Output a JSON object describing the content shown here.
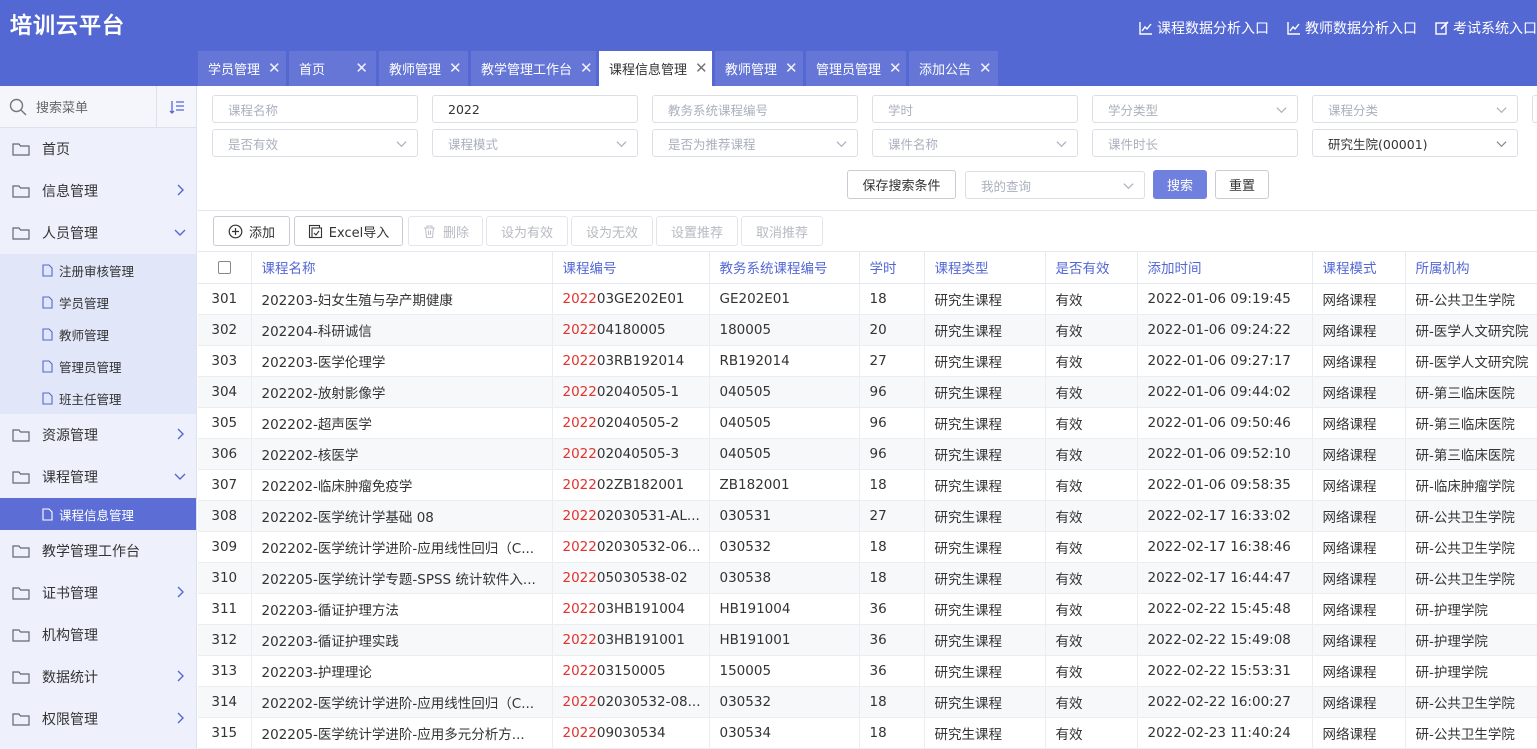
{
  "app": {
    "title": "培训云平台"
  },
  "header_links": [
    {
      "label": "课程数据分析入口",
      "icon": "chart-icon"
    },
    {
      "label": "教师数据分析入口",
      "icon": "chart-icon"
    },
    {
      "label": "考试系统入口",
      "icon": "edit-icon"
    }
  ],
  "tabs": [
    {
      "label": "学员管理",
      "active": false
    },
    {
      "label": "首页",
      "active": false
    },
    {
      "label": "教师管理",
      "active": false
    },
    {
      "label": "教学管理工作台",
      "active": false
    },
    {
      "label": "课程信息管理",
      "active": true
    },
    {
      "label": "教师管理",
      "active": false
    },
    {
      "label": "管理员管理",
      "active": false
    },
    {
      "label": "添加公告",
      "active": false
    }
  ],
  "sidebar": {
    "search_placeholder": "搜索菜单",
    "items": [
      {
        "label": "首页"
      },
      {
        "label": "信息管理"
      },
      {
        "label": "人员管理"
      },
      {
        "label": "资源管理"
      },
      {
        "label": "课程管理"
      },
      {
        "label": "教学管理工作台"
      },
      {
        "label": "证书管理"
      },
      {
        "label": "机构管理"
      },
      {
        "label": "数据统计"
      },
      {
        "label": "权限管理"
      }
    ],
    "personnel_sub": [
      "注册审核管理",
      "学员管理",
      "教师管理",
      "管理员管理",
      "班主任管理"
    ],
    "course_sub": [
      "课程信息管理"
    ]
  },
  "filters": {
    "course_name": "课程名称",
    "year": "2022",
    "edu_code": "教务系统课程编号",
    "hours": "学时",
    "credit_type": "学分类型",
    "course_category": "课程分类",
    "is_valid": "是否有效",
    "course_mode": "课程模式",
    "is_recommended": "是否为推荐课程",
    "courseware_name": "课件名称",
    "courseware_duration": "课件时长",
    "org": "研究生院(00001)",
    "my_query": "我的查询",
    "save_label": "保存搜索条件",
    "search_label": "搜索",
    "reset_label": "重置"
  },
  "toolbar": {
    "add": "添加",
    "excel_import": "Excel导入",
    "delete": "删除",
    "set_valid": "设为有效",
    "set_invalid": "设为无效",
    "set_recommend": "设置推荐",
    "cancel_recommend": "取消推荐"
  },
  "table": {
    "columns": [
      "课程名称",
      "课程编号",
      "教务系统课程编号",
      "学时",
      "课程类型",
      "是否有效",
      "添加时间",
      "课程模式",
      "所属机构"
    ],
    "rows": [
      {
        "idx": "301",
        "name": "202203-妇女生殖与孕产期健康",
        "code_prefix": "2022",
        "code_rest": "03GE202E01",
        "edu": "GE202E01",
        "hours": "18",
        "type": "研究生课程",
        "valid": "有效",
        "time": "2022-01-06 09:19:45",
        "mode": "网络课程",
        "org": "研-公共卫生学院"
      },
      {
        "idx": "302",
        "name": "202204-科研诚信",
        "code_prefix": "2022",
        "code_rest": "04180005",
        "edu": "180005",
        "hours": "20",
        "type": "研究生课程",
        "valid": "有效",
        "time": "2022-01-06 09:24:22",
        "mode": "网络课程",
        "org": "研-医学人文研究院"
      },
      {
        "idx": "303",
        "name": "202203-医学伦理学",
        "code_prefix": "2022",
        "code_rest": "03RB192014",
        "edu": "RB192014",
        "hours": "27",
        "type": "研究生课程",
        "valid": "有效",
        "time": "2022-01-06 09:27:17",
        "mode": "网络课程",
        "org": "研-医学人文研究院"
      },
      {
        "idx": "304",
        "name": "202202-放射影像学",
        "code_prefix": "2022",
        "code_rest": "02040505-1",
        "edu": "040505",
        "hours": "96",
        "type": "研究生课程",
        "valid": "有效",
        "time": "2022-01-06 09:44:02",
        "mode": "网络课程",
        "org": "研-第三临床医院"
      },
      {
        "idx": "305",
        "name": "202202-超声医学",
        "code_prefix": "2022",
        "code_rest": "02040505-2",
        "edu": "040505",
        "hours": "96",
        "type": "研究生课程",
        "valid": "有效",
        "time": "2022-01-06 09:50:46",
        "mode": "网络课程",
        "org": "研-第三临床医院"
      },
      {
        "idx": "306",
        "name": "202202-核医学",
        "code_prefix": "2022",
        "code_rest": "02040505-3",
        "edu": "040505",
        "hours": "96",
        "type": "研究生课程",
        "valid": "有效",
        "time": "2022-01-06 09:52:10",
        "mode": "网络课程",
        "org": "研-第三临床医院"
      },
      {
        "idx": "307",
        "name": "202202-临床肿瘤免疫学",
        "code_prefix": "2022",
        "code_rest": "02ZB182001",
        "edu": "ZB182001",
        "hours": "18",
        "type": "研究生课程",
        "valid": "有效",
        "time": "2022-01-06 09:58:35",
        "mode": "网络课程",
        "org": "研-临床肿瘤学院"
      },
      {
        "idx": "308",
        "name": "202202-医学统计学基础 08",
        "code_prefix": "2022",
        "code_rest": "02030531-AL...",
        "edu": "030531",
        "hours": "27",
        "type": "研究生课程",
        "valid": "有效",
        "time": "2022-02-17 16:33:02",
        "mode": "网络课程",
        "org": "研-公共卫生学院"
      },
      {
        "idx": "309",
        "name": "202202-医学统计学进阶-应用线性回归（C...",
        "code_prefix": "2022",
        "code_rest": "02030532-06...",
        "edu": "030532",
        "hours": "18",
        "type": "研究生课程",
        "valid": "有效",
        "time": "2022-02-17 16:38:46",
        "mode": "网络课程",
        "org": "研-公共卫生学院"
      },
      {
        "idx": "310",
        "name": "202205-医学统计学专题-SPSS 统计软件入...",
        "code_prefix": "2022",
        "code_rest": "05030538-02",
        "edu": "030538",
        "hours": "18",
        "type": "研究生课程",
        "valid": "有效",
        "time": "2022-02-17 16:44:47",
        "mode": "网络课程",
        "org": "研-公共卫生学院"
      },
      {
        "idx": "311",
        "name": "202203-循证护理方法",
        "code_prefix": "2022",
        "code_rest": "03HB191004",
        "edu": "HB191004",
        "hours": "36",
        "type": "研究生课程",
        "valid": "有效",
        "time": "2022-02-22 15:45:48",
        "mode": "网络课程",
        "org": "研-护理学院"
      },
      {
        "idx": "312",
        "name": "202203-循证护理实践",
        "code_prefix": "2022",
        "code_rest": "03HB191001",
        "edu": "HB191001",
        "hours": "36",
        "type": "研究生课程",
        "valid": "有效",
        "time": "2022-02-22 15:49:08",
        "mode": "网络课程",
        "org": "研-护理学院"
      },
      {
        "idx": "313",
        "name": "202203-护理理论",
        "code_prefix": "2022",
        "code_rest": "03150005",
        "edu": "150005",
        "hours": "36",
        "type": "研究生课程",
        "valid": "有效",
        "time": "2022-02-22 15:53:31",
        "mode": "网络课程",
        "org": "研-护理学院"
      },
      {
        "idx": "314",
        "name": "202202-医学统计学进阶-应用线性回归（C...",
        "code_prefix": "2022",
        "code_rest": "02030532-08...",
        "edu": "030532",
        "hours": "18",
        "type": "研究生课程",
        "valid": "有效",
        "time": "2022-02-22 16:00:27",
        "mode": "网络课程",
        "org": "研-公共卫生学院"
      },
      {
        "idx": "315",
        "name": "202205-医学统计学进阶-应用多元分析方...",
        "code_prefix": "2022",
        "code_rest": "09030534",
        "edu": "030534",
        "hours": "18",
        "type": "研究生课程",
        "valid": "有效",
        "time": "2022-02-23 11:40:24",
        "mode": "网络课程",
        "org": "研-公共卫生学院"
      }
    ]
  }
}
